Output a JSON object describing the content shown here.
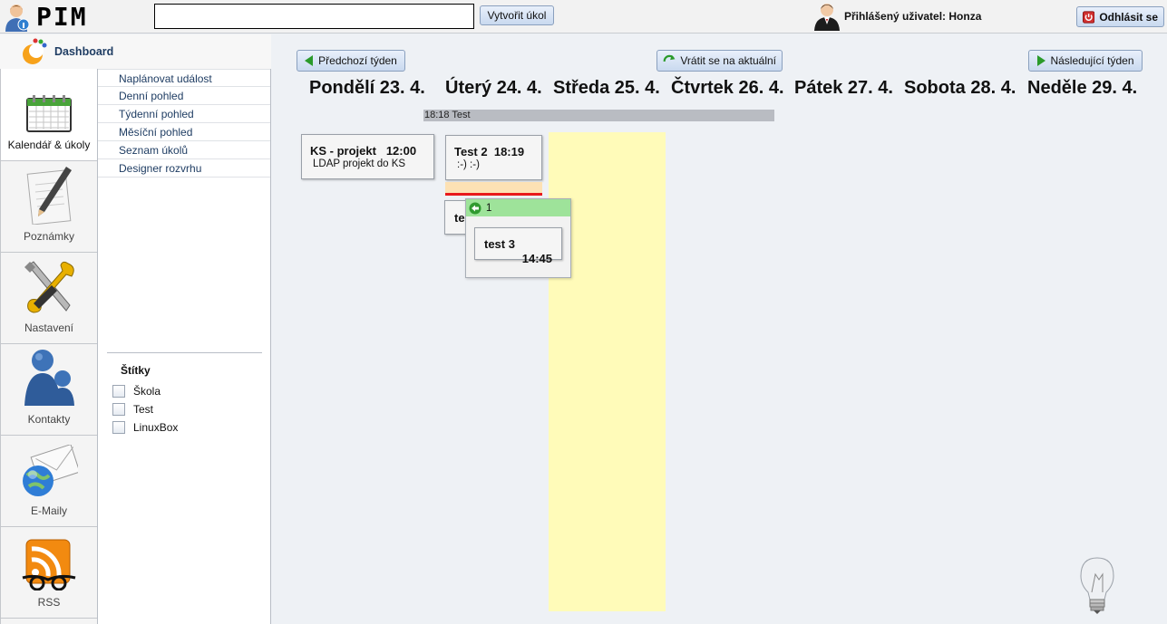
{
  "app": {
    "logo_text": "PIM"
  },
  "header": {
    "search_value": "",
    "create_task_label": "Vytvořit úkol",
    "user_label": "Přihlášený uživatel: Honza",
    "logout_label": "Odhlásit se"
  },
  "dashboard": {
    "label": "Dashboard"
  },
  "apps": [
    {
      "label": "Kalendář & úkoly",
      "icon": "calendar-icon",
      "active": true
    },
    {
      "label": "Poznámky",
      "icon": "notes-icon"
    },
    {
      "label": "Nastavení",
      "icon": "tools-icon"
    },
    {
      "label": "Kontakty",
      "icon": "contacts-icon"
    },
    {
      "label": "E-Maily",
      "icon": "email-icon"
    },
    {
      "label": "RSS",
      "icon": "rss-icon"
    }
  ],
  "submenu": [
    "Naplánovat událost",
    "Denní pohled",
    "Týdenní pohled",
    "Měsíční pohled",
    "Seznam úkolů",
    "Designer rozvrhu"
  ],
  "tags": {
    "title": "Štítky",
    "items": [
      "Škola",
      "Test",
      "LinuxBox"
    ]
  },
  "calendar": {
    "prev_week_label": "Předchozí týden",
    "current_week_label": "Vrátit se na aktuální",
    "next_week_label": "Následující týden",
    "days": [
      "Pondělí 23. 4.",
      "Úterý 24. 4.",
      "Středa 25. 4.",
      "Čtvrtek 26. 4.",
      "Pátek 27. 4.",
      "Sobota 28. 4.",
      "Neděle 29. 4."
    ],
    "allday_event": "18:18 Test",
    "events": {
      "ks": {
        "title": "KS - projekt",
        "time": "12:00",
        "desc": "LDAP projekt do KS"
      },
      "test2": {
        "title": "Test 2",
        "time": "18:19",
        "desc": ":-) :-)"
      },
      "te": {
        "title": "te"
      },
      "test3": {
        "title": "test 3",
        "time": "14:45"
      }
    },
    "overflow_count": "1"
  },
  "colors": {
    "today_column": "#fffbb9",
    "now_line": "#e8191b",
    "overflow_header": "#9ee39a",
    "button_bg": "#c9d9ef"
  }
}
